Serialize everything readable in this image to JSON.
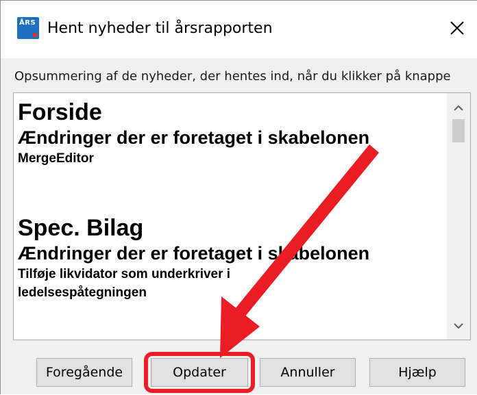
{
  "window": {
    "title": "Hent nyheder til årsrapporten",
    "app_icon_text": "ÅRS",
    "close_icon": "close-icon"
  },
  "summary_text": "Opsummering af de nyheder, der hentes ind, når du klikker på knappe",
  "sections": [
    {
      "heading": "Forside",
      "subheading": "Ændringer der er foretaget i skabelonen",
      "lines": [
        "MergeEditor"
      ]
    },
    {
      "heading": "Spec. Bilag",
      "subheading": "Ændringer der er foretaget i skabelonen",
      "lines": [
        "Tilføje likvidator som underkriver i",
        "ledelsespåtegningen"
      ]
    }
  ],
  "scrollbar": {
    "up_icon": "chevron-up-icon",
    "down_icon": "chevron-down-icon"
  },
  "buttons": {
    "previous": "Foregående",
    "update": "Opdater",
    "cancel": "Annuller",
    "help": "Hjælp"
  },
  "colors": {
    "annotation_red": "#ea1c24",
    "app_icon_blue": "#1d6fbf"
  }
}
